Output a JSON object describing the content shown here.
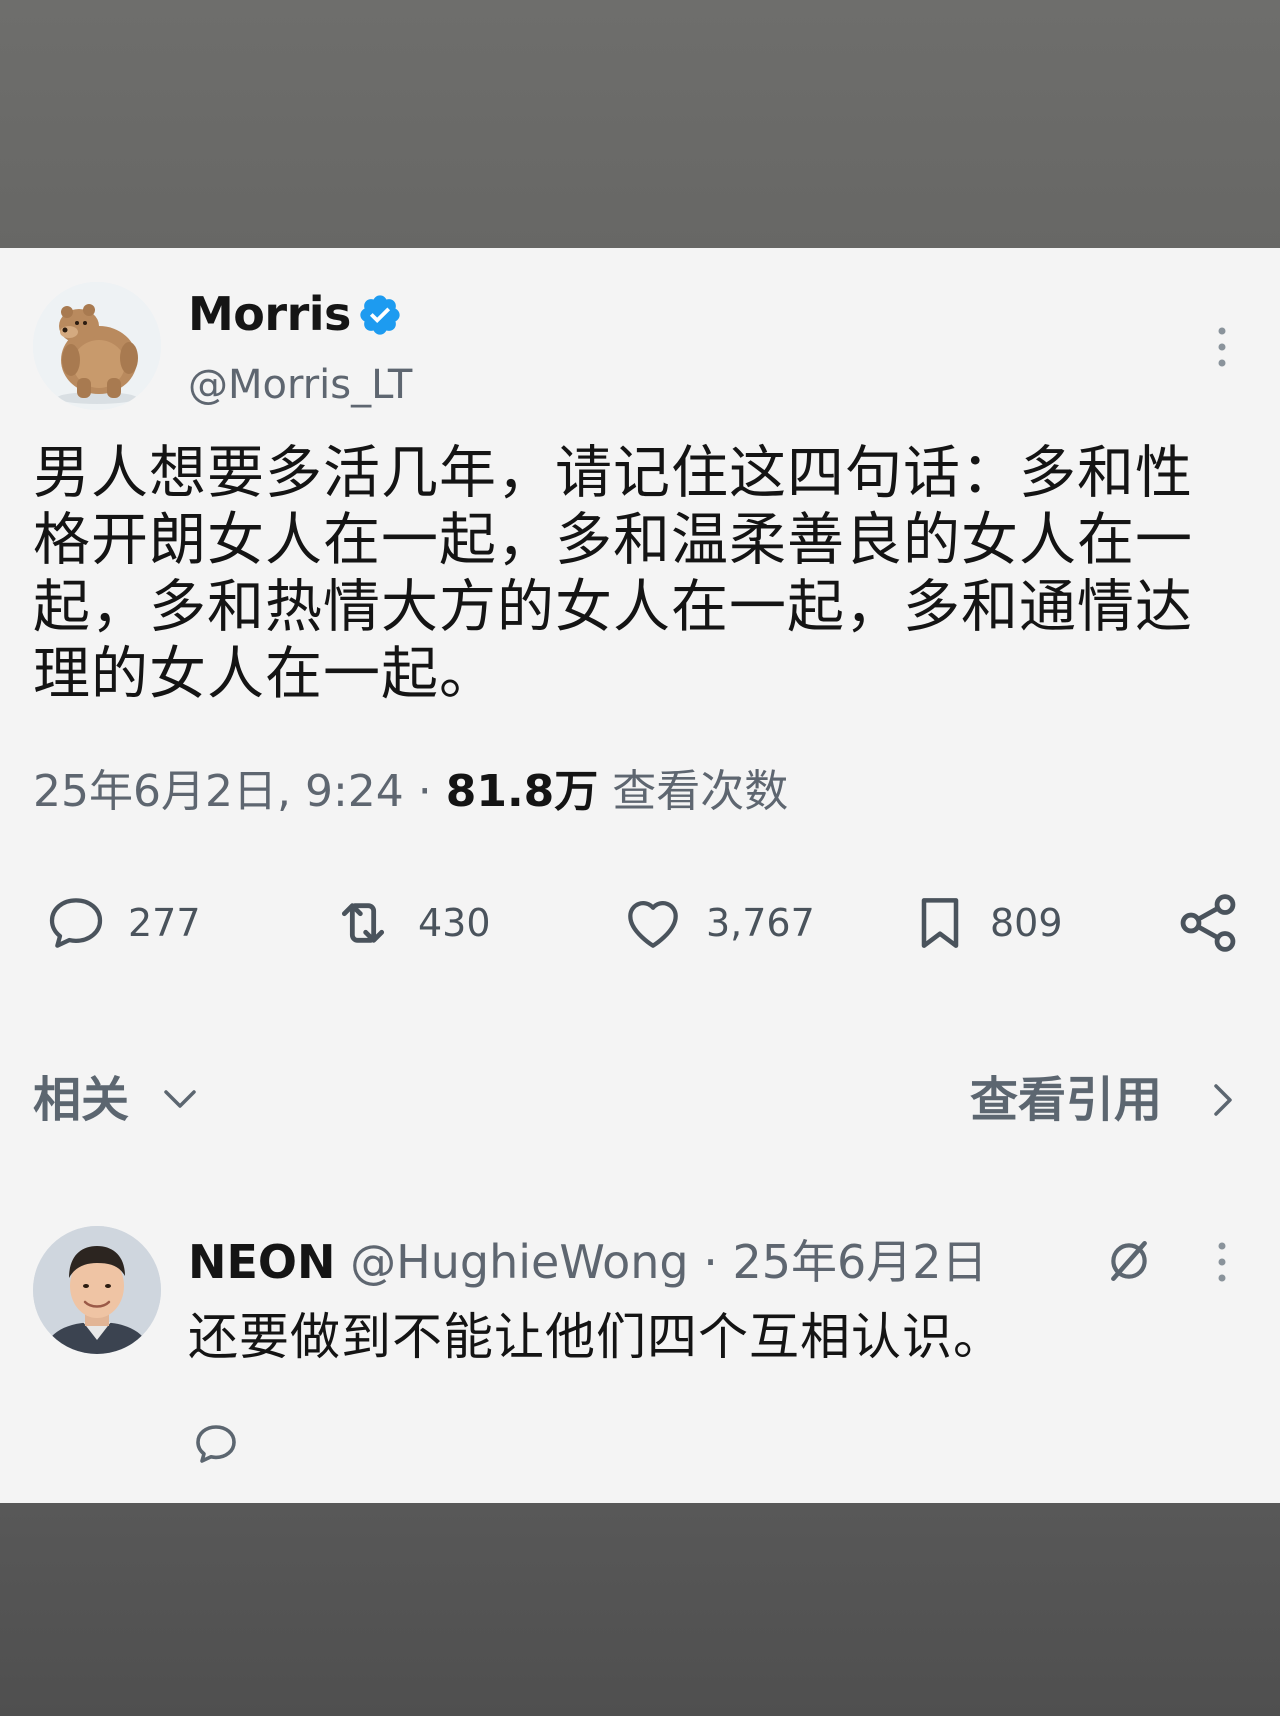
{
  "tweet": {
    "author": {
      "name": "Morris",
      "handle": "@Morris_LT",
      "verified": true
    },
    "text": "男人想要多活几年，请记住这四句话：多和性格开朗女人在一起，多和温柔善良的女人在一起，多和热情大方的女人在一起，多和通情达理的女人在一起。",
    "date": "25年6月2日, 9:24 · ",
    "views": "81.8万",
    "views_label": " 查看次数",
    "actions": {
      "replies": "277",
      "retweets": "430",
      "likes": "3,767",
      "bookmarks": "809"
    }
  },
  "related": {
    "label": "相关",
    "quotes_label": "查看引用"
  },
  "reply": {
    "name": "NEON",
    "handle": " @HughieWong · 25年6月2日",
    "text": "还要做到不能让他们四个互相认识。"
  },
  "colors": {
    "accent": "#1d9bf0",
    "text_primary": "#141414",
    "text_secondary": "#5e6670",
    "card_bg": "#f4f4f4",
    "band_bg": "#6e6e6c"
  },
  "icons": {
    "verified": "verified-badge-icon",
    "more": "more-vertical-icon",
    "reply": "comment-icon",
    "retweet": "retweet-icon",
    "like": "heart-icon",
    "bookmark": "bookmark-icon",
    "share": "share-icon",
    "chevron_down": "chevron-down-icon",
    "chevron_right": "chevron-right-icon",
    "grok": "grok-icon"
  }
}
